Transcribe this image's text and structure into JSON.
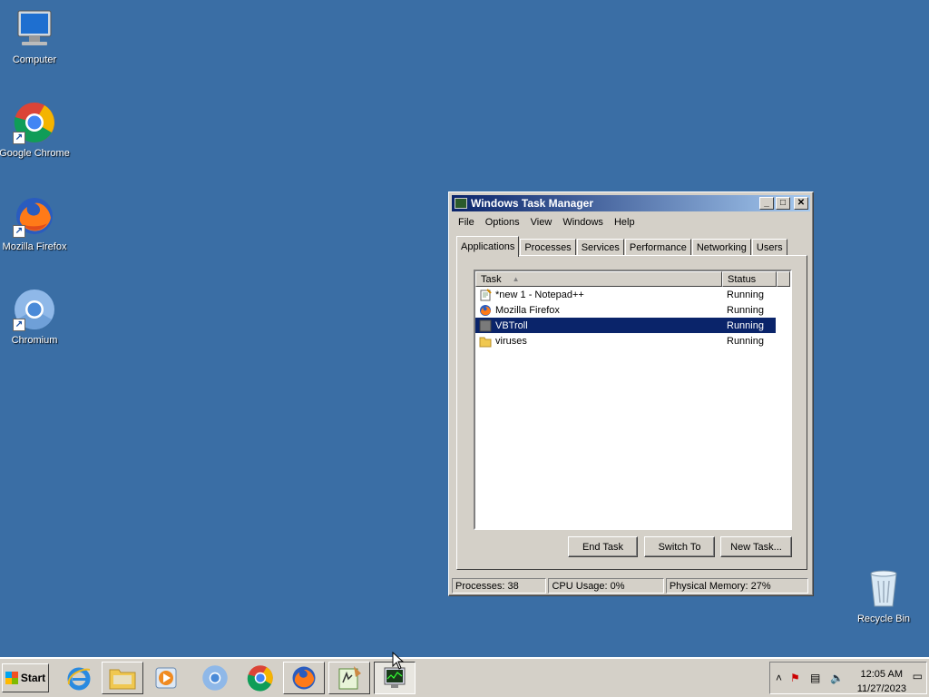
{
  "desktop": {
    "icons": [
      {
        "label": "Computer",
        "icon": "computer-icon"
      },
      {
        "label": "Google Chrome",
        "icon": "chrome-icon"
      },
      {
        "label": "Mozilla Firefox",
        "icon": "firefox-icon"
      },
      {
        "label": "Chromium",
        "icon": "chromium-icon"
      },
      {
        "label": "Recycle Bin",
        "icon": "recycle-bin-icon"
      }
    ]
  },
  "window": {
    "title": "Windows Task Manager",
    "menu": [
      "File",
      "Options",
      "View",
      "Windows",
      "Help"
    ],
    "tabs": [
      "Applications",
      "Processes",
      "Services",
      "Performance",
      "Networking",
      "Users"
    ],
    "active_tab": "Applications",
    "columns": {
      "task": "Task",
      "status": "Status"
    },
    "rows": [
      {
        "task": "*new 1 - Notepad++",
        "status": "Running",
        "icon": "notepad-icon"
      },
      {
        "task": "Mozilla Firefox",
        "status": "Running",
        "icon": "firefox-icon"
      },
      {
        "task": "VBTroll",
        "status": "Running",
        "icon": "app-icon",
        "selected": true
      },
      {
        "task": "viruses",
        "status": "Running",
        "icon": "folder-icon"
      }
    ],
    "buttons": {
      "end_task": "End Task",
      "switch_to": "Switch To",
      "new_task": "New Task..."
    },
    "status": {
      "processes": "Processes: 38",
      "cpu": "CPU Usage: 0%",
      "memory": "Physical Memory: 27%"
    }
  },
  "taskbar": {
    "start_label": "Start",
    "clock_time": "12:05 AM",
    "clock_date": "11/27/2023",
    "items": [
      "internet-explorer-icon",
      "file-explorer-icon",
      "media-player-icon",
      "chromium-icon",
      "chrome-icon",
      "firefox-icon",
      "notepad-plus-plus-icon",
      "task-manager-icon"
    ]
  },
  "colors": {
    "desktop": "#3a6ea5",
    "selection": "#0a246a",
    "title_start": "#0a246a",
    "title_end": "#a6caf0"
  }
}
